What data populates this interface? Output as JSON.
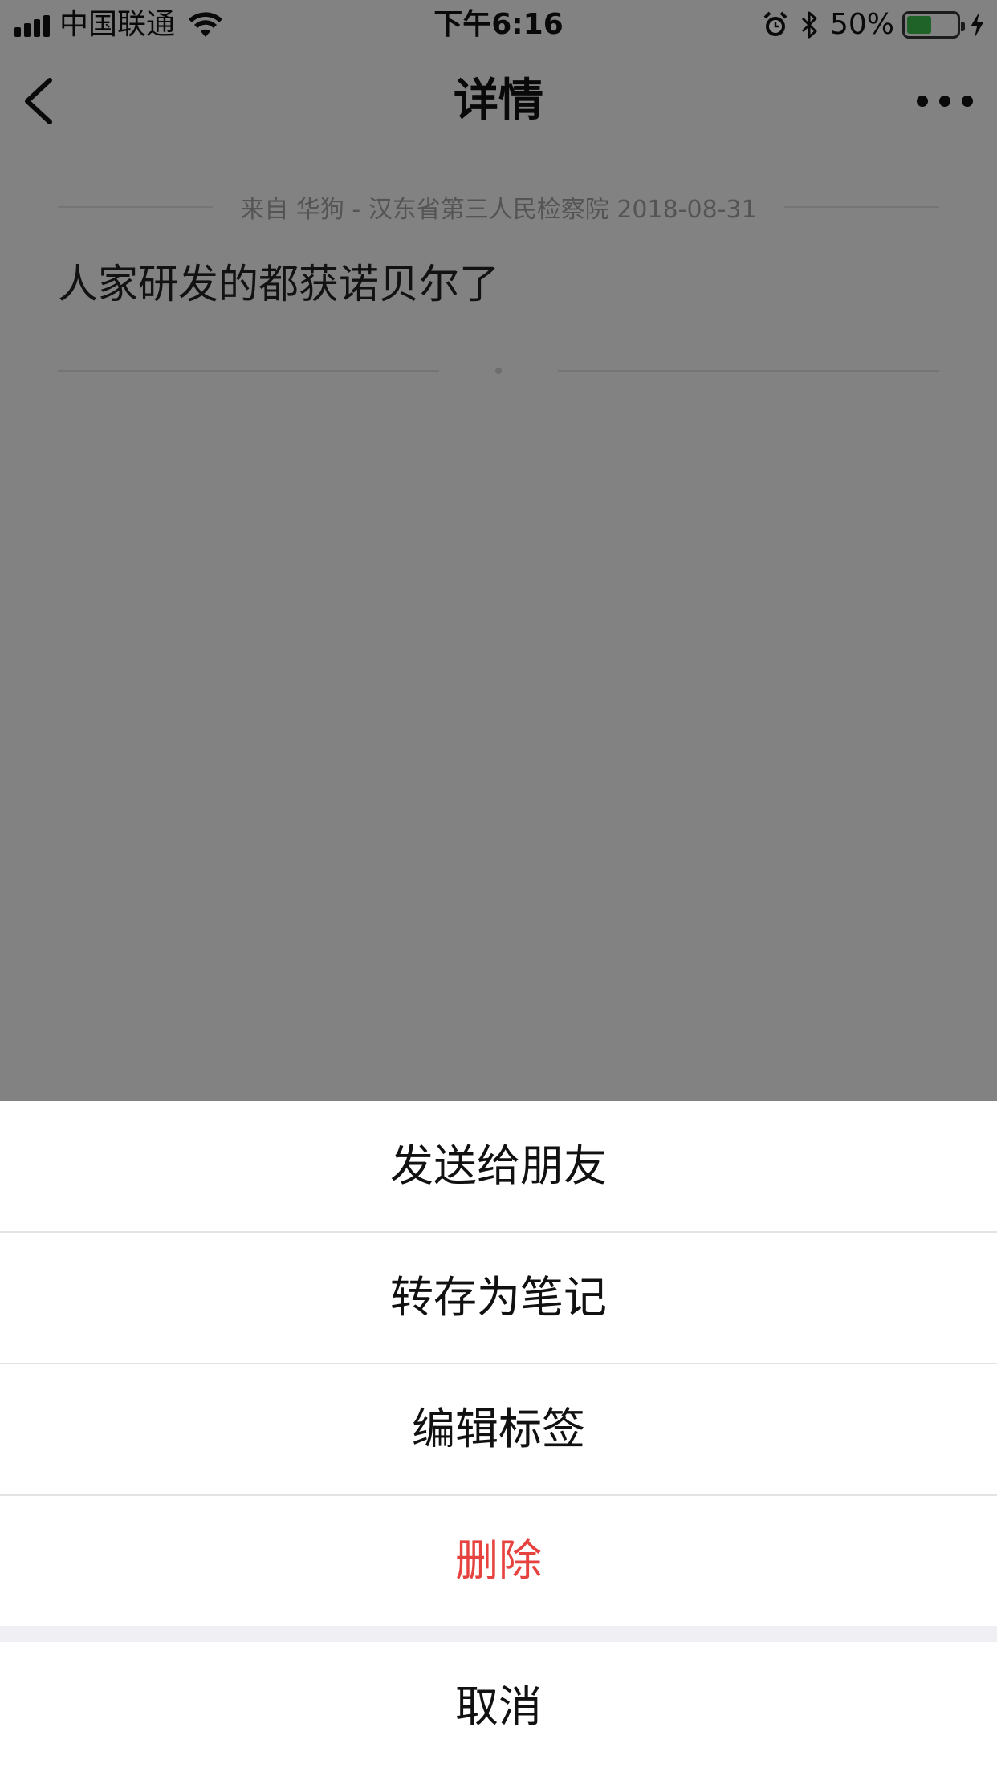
{
  "status_bar": {
    "carrier": "中国联通",
    "time": "下午6:16",
    "battery_percent": "50%",
    "battery_level": 0.5,
    "icons": [
      "signal-icon",
      "wifi-icon",
      "alarm-icon",
      "bluetooth-icon",
      "battery-icon",
      "charging-icon"
    ]
  },
  "nav": {
    "title": "详情",
    "back_icon": "chevron-left-icon",
    "more_icon": "more-dots-icon"
  },
  "content": {
    "source": "来自 华狗 - 汉东省第三人民检察院 2018-08-31",
    "text": "人家研发的都获诺贝尔了"
  },
  "action_sheet": {
    "items": [
      {
        "label": "发送给朋友"
      },
      {
        "label": "转存为笔记"
      },
      {
        "label": "编辑标签"
      },
      {
        "label": "删除",
        "color": "#e64340"
      }
    ],
    "cancel": "取消"
  },
  "colors": {
    "overlay": "rgba(0,0,0,0.45)",
    "danger": "#e64340",
    "battery_fill": "#3bb54a"
  }
}
